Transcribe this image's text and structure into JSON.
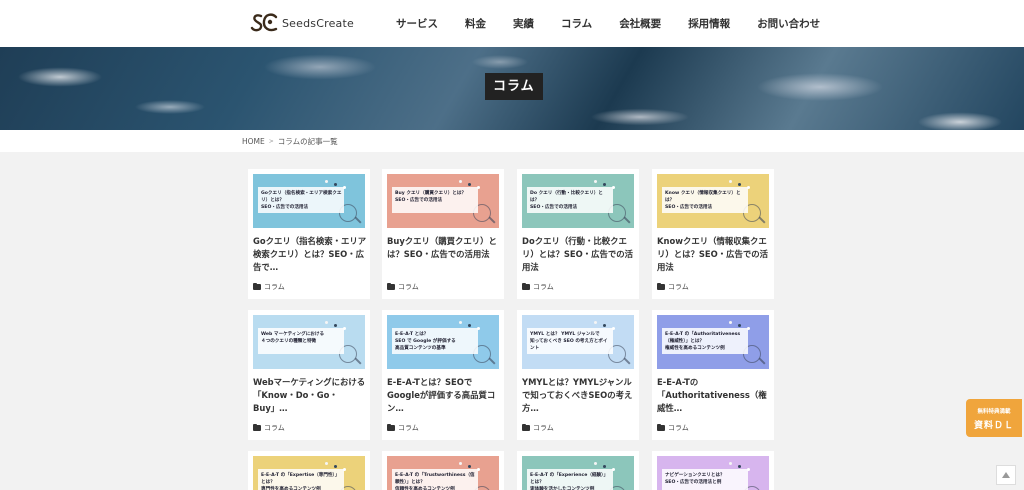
{
  "header": {
    "logo_text": "SeedsCreate",
    "nav": [
      "サービス",
      "料金",
      "実績",
      "コラム",
      "会社概要",
      "採用情報",
      "お問い合わせ"
    ]
  },
  "hero": {
    "title": "コラム"
  },
  "breadcrumb": {
    "home": "HOME",
    "current": "コラムの記事一覧"
  },
  "cards": [
    {
      "thumb_color": "#7fc4dc",
      "thumb_text": "Goクエリ（指名検索・エリア検索クエリ）とは？\nSEO・広告での活用法",
      "title": "Goクエリ（指名検索・エリア検索クエリ）とは？SEO・広告で…",
      "category": "コラム"
    },
    {
      "thumb_color": "#e8a190",
      "thumb_text": "Buy クエリ（購買クエリ）とは？\nSEO・広告での活用法",
      "title": "Buyクエリ（購買クエリ）とは？SEO・広告での活用法",
      "category": "コラム"
    },
    {
      "thumb_color": "#8cc6bb",
      "thumb_text": "Do クエリ（行動・比較クエリ）とは？\nSEO・広告での活用法",
      "title": "Doクエリ（行動・比較クエリ）とは？SEO・広告での活用法",
      "category": "コラム"
    },
    {
      "thumb_color": "#ecd27a",
      "thumb_text": "Know クエリ（情報収集クエリ）とは？\nSEO・広告での活用法",
      "title": "Knowクエリ（情報収集クエリ）とは？SEO・広告での活用法",
      "category": "コラム"
    },
    {
      "thumb_color": "#b9dcf0",
      "thumb_text": "Web マーケティングにおける\n４つのクエリの種類と特徴",
      "title": "Webマーケティングにおける「Know・Do・Go・Buy」…",
      "category": "コラム"
    },
    {
      "thumb_color": "#8fcaea",
      "thumb_text": "E-E-A-T とは？\nSEO で Google が評価する\n高品質コンテンツの基準",
      "title": "E-E-A-Tとは？SEOでGoogleが評価する高品質コン…",
      "category": "コラム"
    },
    {
      "thumb_color": "#c2dcf4",
      "thumb_text": "YMYL とは？ YMYL ジャンルで\n知っておくべき SEO の考え方とポイント",
      "title": "YMYLとは？YMYLジャンルで知っておくべきSEOの考え方…",
      "category": "コラム"
    },
    {
      "thumb_color": "#8f9ee8",
      "thumb_text": "E-E-A-T の「Authoritativeness（権威性）」とは？\n権威性を高めるコンテンツ例",
      "title": "E-E-A-Tの「Authoritativeness（権威性…",
      "category": "コラム"
    },
    {
      "thumb_color": "#ecd27a",
      "thumb_text": "E-E-A-T の「Expertise（専門性）」とは？\n専門性を高めるコンテンツ例",
      "title": "",
      "category": ""
    },
    {
      "thumb_color": "#e8a190",
      "thumb_text": "E-E-A-T の「Trustworthiness（信頼性）」とは？\n信頼性を高めるコンテンツ例",
      "title": "",
      "category": ""
    },
    {
      "thumb_color": "#8cc6bb",
      "thumb_text": "E-E-A-T の「Experience（経験）」とは？\n実体験を活かしたコンテンツ例",
      "title": "",
      "category": ""
    },
    {
      "thumb_color": "#d7b5ee",
      "thumb_text": "ナビゲーションクエリとは？\nSEO・広告での活用法と例",
      "title": "",
      "category": ""
    }
  ],
  "cta": {
    "small": "無料特典満載",
    "big": "資料ＤＬ"
  }
}
